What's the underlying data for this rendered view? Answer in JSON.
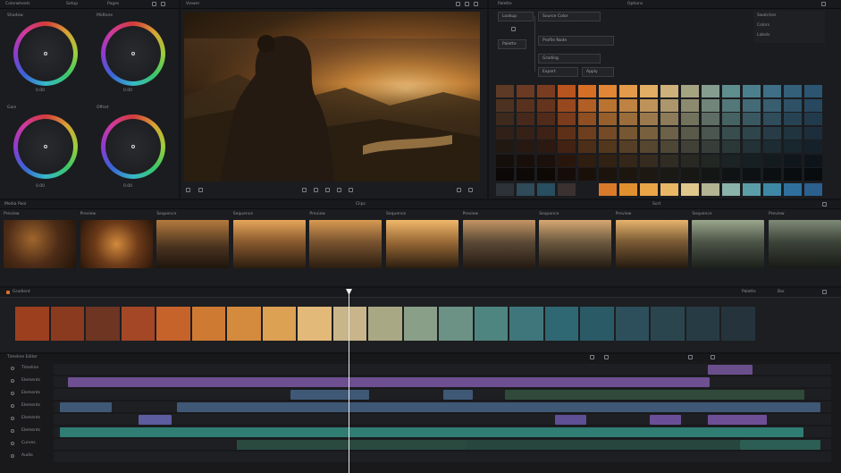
{
  "app": {
    "color_panel_title": "Colorwheels",
    "color_panel_mid": "Setup",
    "color_panel_right": "Pages",
    "viewer_title": "Viewer",
    "palette_title": "Palette",
    "palette_right": "Options"
  },
  "wheels": [
    {
      "label": "Shadow",
      "value": "0.00"
    },
    {
      "label": "Midtone",
      "value": "0.00"
    },
    {
      "label": "Gain",
      "value": "0.00"
    },
    {
      "label": "Offset",
      "value": "0.00"
    }
  ],
  "node_tree": {
    "root": "Lookup",
    "items": [
      "Source Color",
      "Palette",
      "Profile Node",
      "Grading"
    ],
    "buttons": [
      "Export",
      "Apply"
    ]
  },
  "palette_side": {
    "items": [
      "Swatches",
      "Colors",
      "Labels"
    ]
  },
  "media_bar": {
    "title": "Media Pool",
    "center": "Clips",
    "right": "Sort"
  },
  "thumb_labels": [
    "Preview",
    "Preview",
    "Sequence",
    "Sequence",
    "Preview",
    "Sequence",
    "Preview",
    "Sequence",
    "Preview",
    "Sequence",
    "Preview"
  ],
  "strip": {
    "title": "Gradient",
    "right_label": "Palette",
    "right_value": "Bar"
  },
  "timeline": {
    "title": "Timeline Editor",
    "tracks": [
      "Timeline",
      "Elements",
      "Elements",
      "Elements",
      "Elements",
      "Elements",
      "Curves",
      "Audio"
    ],
    "selection_label": "Selection Range"
  },
  "colors": {
    "accent_orange": "#d88a3a",
    "purple_clip": "#6e4f91",
    "teal_clip": "#2f7d73",
    "blue_clip": "#3f5876"
  }
}
